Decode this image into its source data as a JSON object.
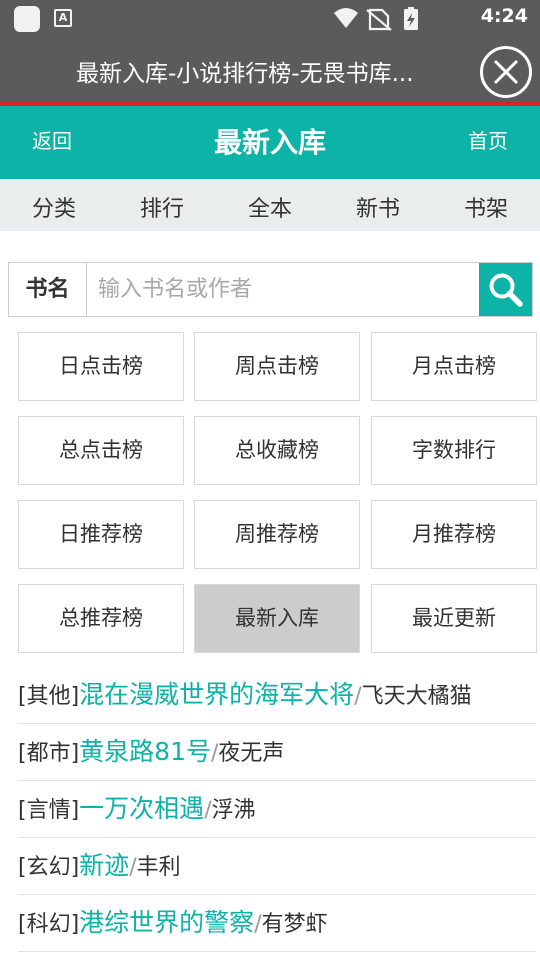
{
  "status_bar": {
    "time": "4:24",
    "app_badge": "A"
  },
  "window": {
    "title": "最新入库-小说排行榜-无畏书库..."
  },
  "header": {
    "back_label": "返回",
    "title": "最新入库",
    "home_label": "首页"
  },
  "nav": {
    "items": [
      "分类",
      "排行",
      "全本",
      "新书",
      "书架"
    ]
  },
  "search": {
    "label": "书名",
    "placeholder": "输入书名或作者",
    "value": ""
  },
  "rankings": {
    "items": [
      "日点击榜",
      "周点击榜",
      "月点击榜",
      "总点击榜",
      "总收藏榜",
      "字数排行",
      "日推荐榜",
      "周推荐榜",
      "月推荐榜",
      "总推荐榜",
      "最新入库",
      "最近更新"
    ],
    "active": "最新入库"
  },
  "books": [
    {
      "category": "[其他]",
      "title": "混在漫威世界的海军大将",
      "sep": "/",
      "author": "飞天大橘猫"
    },
    {
      "category": "[都市]",
      "title": "黄泉路81号",
      "sep": "/",
      "author": "夜无声"
    },
    {
      "category": "[言情]",
      "title": "一万次相遇",
      "sep": "/",
      "author": "浮沸"
    },
    {
      "category": "[玄幻]",
      "title": "新迹",
      "sep": "/",
      "author": "丰利"
    },
    {
      "category": "[科幻]",
      "title": "港综世界的警察",
      "sep": "/",
      "author": "有梦虾"
    }
  ],
  "colors": {
    "accent": "#0db3a6",
    "toolbar": "#5b5b5b",
    "divider_red": "#d8232a",
    "active_cell": "#cccccc"
  }
}
